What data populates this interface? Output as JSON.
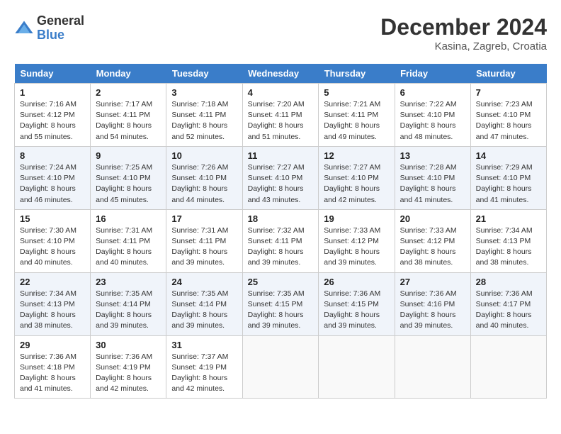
{
  "header": {
    "logo_general": "General",
    "logo_blue": "Blue",
    "month_title": "December 2024",
    "location": "Kasina, Zagreb, Croatia"
  },
  "weekdays": [
    "Sunday",
    "Monday",
    "Tuesday",
    "Wednesday",
    "Thursday",
    "Friday",
    "Saturday"
  ],
  "weeks": [
    [
      {
        "day": "1",
        "sunrise": "7:16 AM",
        "sunset": "4:12 PM",
        "daylight": "8 hours and 55 minutes."
      },
      {
        "day": "2",
        "sunrise": "7:17 AM",
        "sunset": "4:11 PM",
        "daylight": "8 hours and 54 minutes."
      },
      {
        "day": "3",
        "sunrise": "7:18 AM",
        "sunset": "4:11 PM",
        "daylight": "8 hours and 52 minutes."
      },
      {
        "day": "4",
        "sunrise": "7:20 AM",
        "sunset": "4:11 PM",
        "daylight": "8 hours and 51 minutes."
      },
      {
        "day": "5",
        "sunrise": "7:21 AM",
        "sunset": "4:11 PM",
        "daylight": "8 hours and 49 minutes."
      },
      {
        "day": "6",
        "sunrise": "7:22 AM",
        "sunset": "4:10 PM",
        "daylight": "8 hours and 48 minutes."
      },
      {
        "day": "7",
        "sunrise": "7:23 AM",
        "sunset": "4:10 PM",
        "daylight": "8 hours and 47 minutes."
      }
    ],
    [
      {
        "day": "8",
        "sunrise": "7:24 AM",
        "sunset": "4:10 PM",
        "daylight": "8 hours and 46 minutes."
      },
      {
        "day": "9",
        "sunrise": "7:25 AM",
        "sunset": "4:10 PM",
        "daylight": "8 hours and 45 minutes."
      },
      {
        "day": "10",
        "sunrise": "7:26 AM",
        "sunset": "4:10 PM",
        "daylight": "8 hours and 44 minutes."
      },
      {
        "day": "11",
        "sunrise": "7:27 AM",
        "sunset": "4:10 PM",
        "daylight": "8 hours and 43 minutes."
      },
      {
        "day": "12",
        "sunrise": "7:27 AM",
        "sunset": "4:10 PM",
        "daylight": "8 hours and 42 minutes."
      },
      {
        "day": "13",
        "sunrise": "7:28 AM",
        "sunset": "4:10 PM",
        "daylight": "8 hours and 41 minutes."
      },
      {
        "day": "14",
        "sunrise": "7:29 AM",
        "sunset": "4:10 PM",
        "daylight": "8 hours and 41 minutes."
      }
    ],
    [
      {
        "day": "15",
        "sunrise": "7:30 AM",
        "sunset": "4:10 PM",
        "daylight": "8 hours and 40 minutes."
      },
      {
        "day": "16",
        "sunrise": "7:31 AM",
        "sunset": "4:11 PM",
        "daylight": "8 hours and 40 minutes."
      },
      {
        "day": "17",
        "sunrise": "7:31 AM",
        "sunset": "4:11 PM",
        "daylight": "8 hours and 39 minutes."
      },
      {
        "day": "18",
        "sunrise": "7:32 AM",
        "sunset": "4:11 PM",
        "daylight": "8 hours and 39 minutes."
      },
      {
        "day": "19",
        "sunrise": "7:33 AM",
        "sunset": "4:12 PM",
        "daylight": "8 hours and 39 minutes."
      },
      {
        "day": "20",
        "sunrise": "7:33 AM",
        "sunset": "4:12 PM",
        "daylight": "8 hours and 38 minutes."
      },
      {
        "day": "21",
        "sunrise": "7:34 AM",
        "sunset": "4:13 PM",
        "daylight": "8 hours and 38 minutes."
      }
    ],
    [
      {
        "day": "22",
        "sunrise": "7:34 AM",
        "sunset": "4:13 PM",
        "daylight": "8 hours and 38 minutes."
      },
      {
        "day": "23",
        "sunrise": "7:35 AM",
        "sunset": "4:14 PM",
        "daylight": "8 hours and 39 minutes."
      },
      {
        "day": "24",
        "sunrise": "7:35 AM",
        "sunset": "4:14 PM",
        "daylight": "8 hours and 39 minutes."
      },
      {
        "day": "25",
        "sunrise": "7:35 AM",
        "sunset": "4:15 PM",
        "daylight": "8 hours and 39 minutes."
      },
      {
        "day": "26",
        "sunrise": "7:36 AM",
        "sunset": "4:15 PM",
        "daylight": "8 hours and 39 minutes."
      },
      {
        "day": "27",
        "sunrise": "7:36 AM",
        "sunset": "4:16 PM",
        "daylight": "8 hours and 39 minutes."
      },
      {
        "day": "28",
        "sunrise": "7:36 AM",
        "sunset": "4:17 PM",
        "daylight": "8 hours and 40 minutes."
      }
    ],
    [
      {
        "day": "29",
        "sunrise": "7:36 AM",
        "sunset": "4:18 PM",
        "daylight": "8 hours and 41 minutes."
      },
      {
        "day": "30",
        "sunrise": "7:36 AM",
        "sunset": "4:19 PM",
        "daylight": "8 hours and 42 minutes."
      },
      {
        "day": "31",
        "sunrise": "7:37 AM",
        "sunset": "4:19 PM",
        "daylight": "8 hours and 42 minutes."
      },
      null,
      null,
      null,
      null
    ]
  ]
}
